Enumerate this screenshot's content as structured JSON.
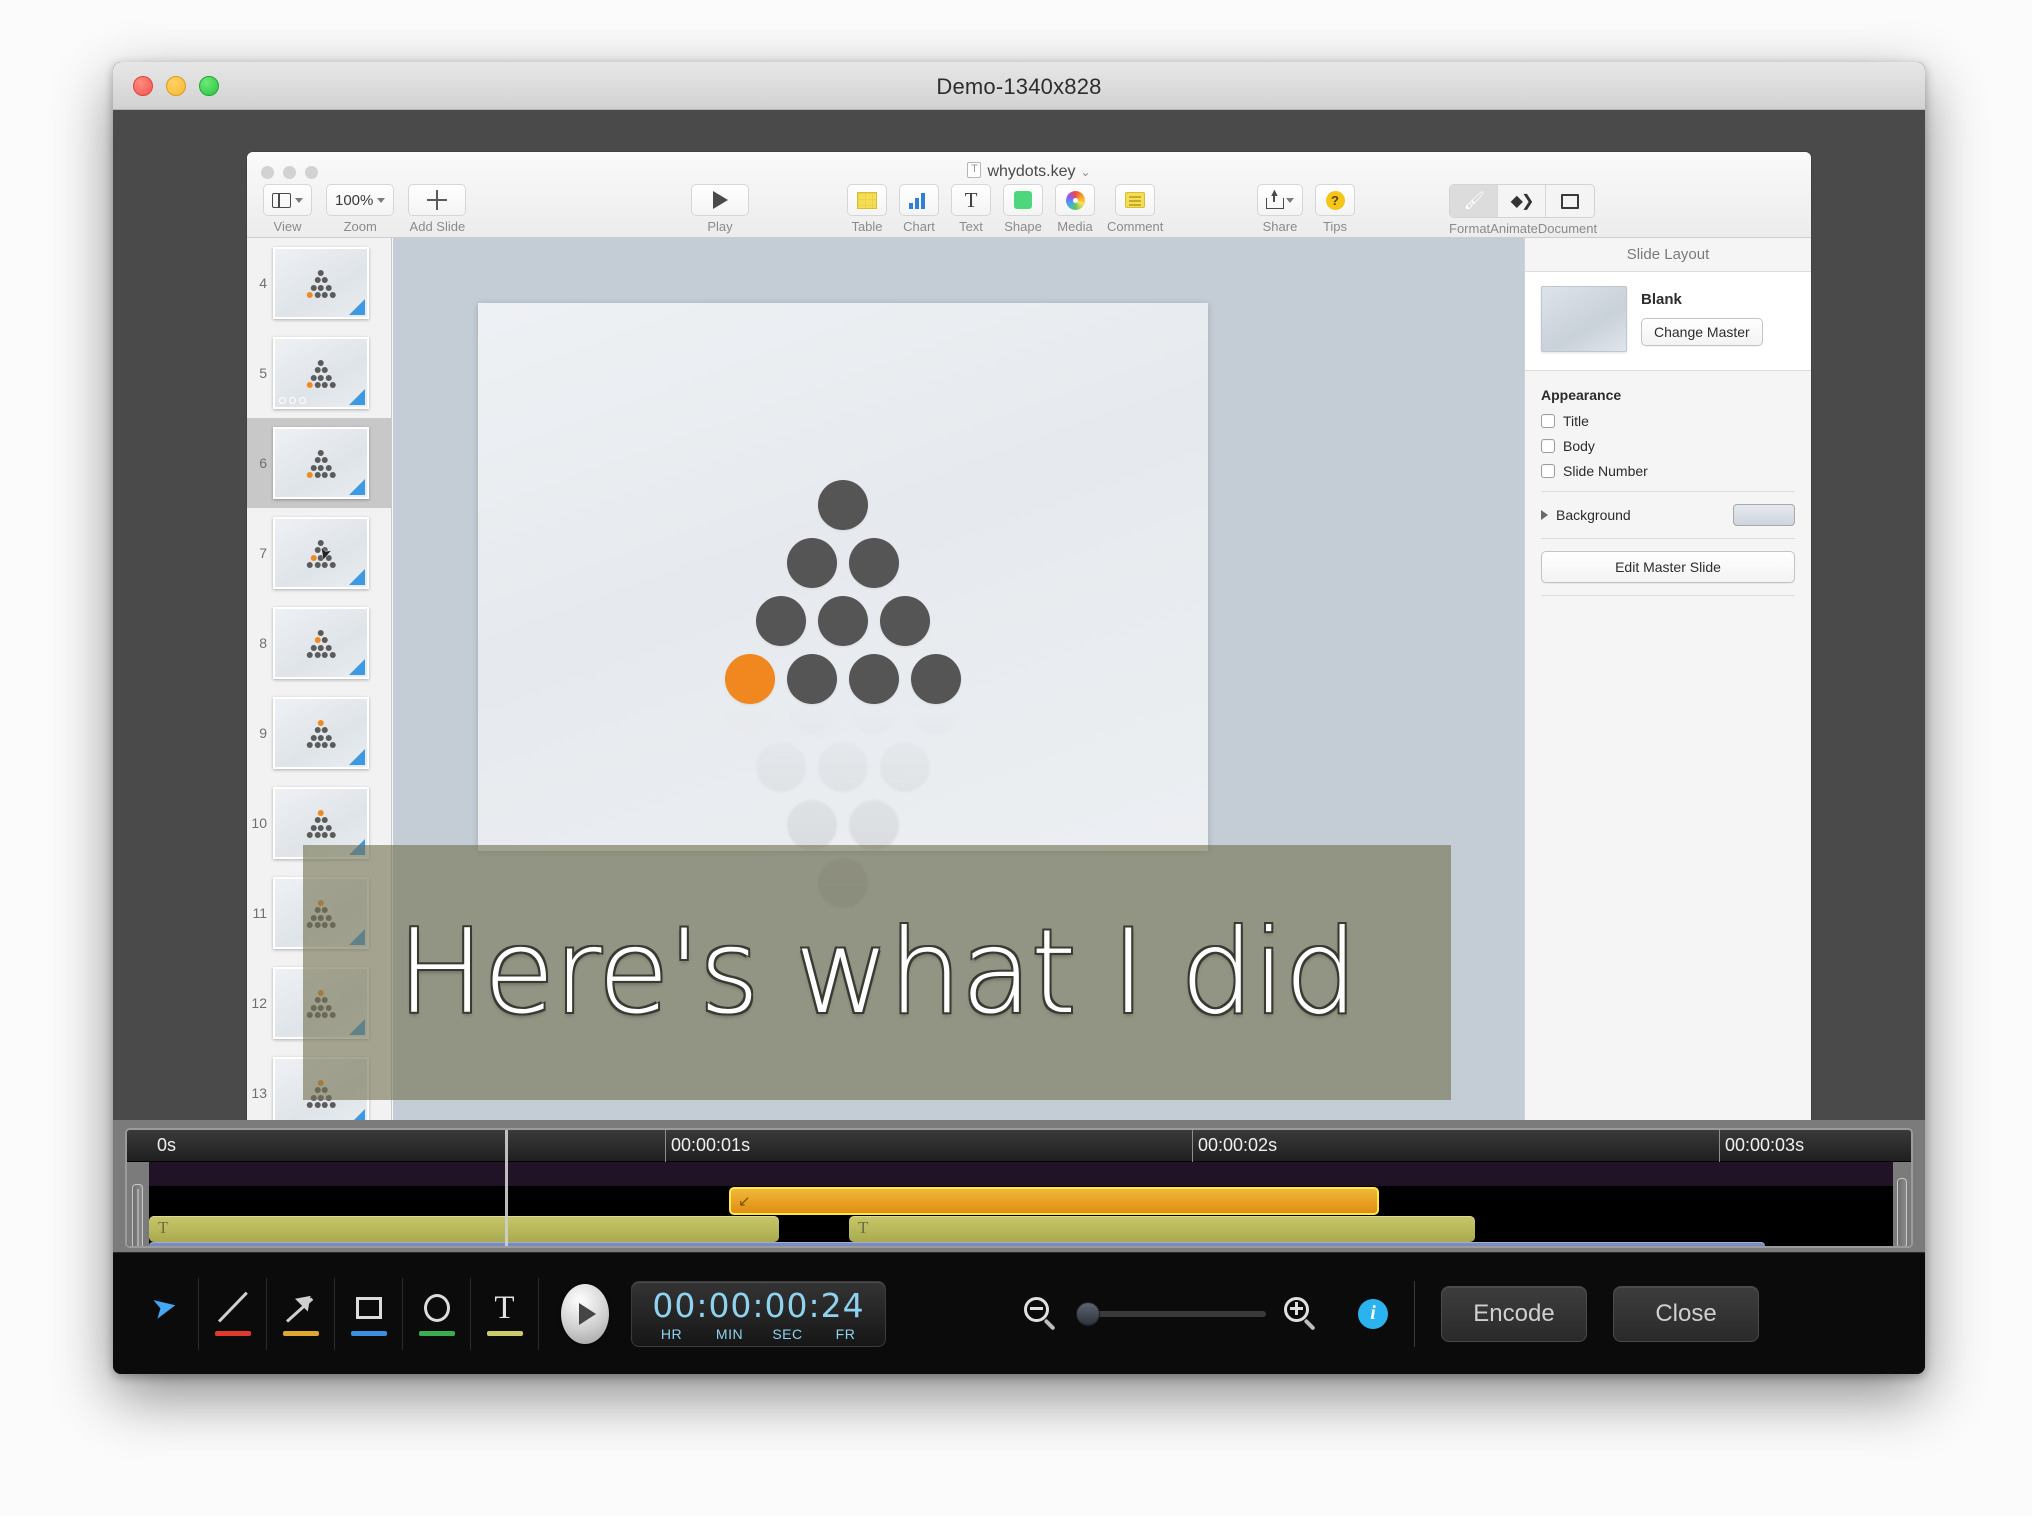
{
  "window": {
    "title": "Demo-1340x828",
    "traffic_lights": [
      "close",
      "minimize",
      "zoom"
    ]
  },
  "keynote": {
    "document_name": "whydots.key",
    "toolbar_left": [
      {
        "label": "View",
        "icon": "view-icon"
      },
      {
        "label": "Zoom",
        "icon": "zoom-value",
        "value": "100%"
      },
      {
        "label": "Add Slide",
        "icon": "plus-icon"
      }
    ],
    "toolbar_center": [
      {
        "label": "Play",
        "icon": "play-icon"
      },
      {
        "label": "Table",
        "icon": "table-icon"
      },
      {
        "label": "Chart",
        "icon": "chart-icon"
      },
      {
        "label": "Text",
        "icon": "text-icon"
      },
      {
        "label": "Shape",
        "icon": "shape-icon"
      },
      {
        "label": "Media",
        "icon": "media-icon"
      },
      {
        "label": "Comment",
        "icon": "comment-icon"
      }
    ],
    "toolbar_right": [
      {
        "label": "Share",
        "icon": "share-icon"
      },
      {
        "label": "Tips",
        "icon": "tips-icon"
      }
    ],
    "inspector_tabs": [
      {
        "label": "Format",
        "icon": "format-icon",
        "selected": true
      },
      {
        "label": "Animate",
        "icon": "animate-icon",
        "selected": false
      },
      {
        "label": "Document",
        "icon": "document-icon",
        "selected": false
      }
    ],
    "navigator": {
      "slides": [
        {
          "number": "4",
          "selected": false,
          "orange_position": "bottom-left",
          "cursor": false,
          "build_dots": 0
        },
        {
          "number": "5",
          "selected": false,
          "orange_position": "bottom-left",
          "cursor": false,
          "build_dots": 3
        },
        {
          "number": "6",
          "selected": true,
          "orange_position": "bottom-left",
          "cursor": false,
          "build_dots": 0
        },
        {
          "number": "7",
          "selected": false,
          "orange_position": "middle-left",
          "cursor": true,
          "build_dots": 0
        },
        {
          "number": "8",
          "selected": false,
          "orange_position": "second-left",
          "cursor": false,
          "build_dots": 0
        },
        {
          "number": "9",
          "selected": false,
          "orange_position": "apex",
          "cursor": false,
          "build_dots": 0
        },
        {
          "number": "10",
          "selected": false,
          "orange_position": "apex",
          "cursor": false,
          "build_dots": 0
        },
        {
          "number": "11",
          "selected": false,
          "orange_position": "apex",
          "cursor": false,
          "build_dots": 0
        },
        {
          "number": "12",
          "selected": false,
          "orange_position": "apex",
          "cursor": false,
          "build_dots": 0
        },
        {
          "number": "13",
          "selected": false,
          "orange_position": "apex",
          "cursor": false,
          "build_dots": 0
        }
      ]
    },
    "slide_canvas": {
      "pyramid": {
        "rows": [
          1,
          2,
          3,
          4
        ],
        "orange_index": {
          "row": 3,
          "col": 0
        },
        "dot_color": "#555555",
        "orange_color": "#f0881f"
      },
      "background_color": "#c4ccd5"
    },
    "inspector": {
      "title": "Slide Layout",
      "master_name": "Blank",
      "change_master_label": "Change Master",
      "appearance_heading": "Appearance",
      "checkboxes": [
        {
          "label": "Title",
          "checked": false
        },
        {
          "label": "Body",
          "checked": false
        },
        {
          "label": "Slide Number",
          "checked": false
        }
      ],
      "background_label": "Background",
      "background_swatch": "#d9dfe6",
      "edit_master_label": "Edit Master Slide"
    }
  },
  "caption": {
    "text": "Here's what I did",
    "background_color": "rgba(116,115,82,.62)",
    "text_color": "#ffffff"
  },
  "timeline": {
    "ruler_ticks": [
      "0s",
      "00:00:01s",
      "00:00:02s",
      "00:00:03s"
    ],
    "tracks": [
      {
        "name": "audio-track",
        "type": "empty",
        "color": "#201326"
      },
      {
        "name": "animation-track",
        "type": "clip",
        "color": "#e08e12",
        "border_color": "#ffe94a",
        "icon": "arrow-down-left-icon"
      },
      {
        "name": "text-track",
        "type": "clips",
        "color": "#a9a94f",
        "icon": "text-icon",
        "clip_count": 2
      },
      {
        "name": "slide-track",
        "type": "video",
        "color": "#6b7ab0"
      }
    ],
    "playhead_label": "playhead"
  },
  "bottom_toolbar": {
    "tools": [
      {
        "name": "select-tool",
        "icon": "cursor-arrow-icon",
        "underline_color": "none"
      },
      {
        "name": "line-tool",
        "icon": "line-icon",
        "underline_color": "#e03a2f"
      },
      {
        "name": "arrow-tool",
        "icon": "arrow-icon",
        "underline_color": "#e0a72f"
      },
      {
        "name": "rectangle-tool",
        "icon": "rectangle-icon",
        "underline_color": "#3a8fe0"
      },
      {
        "name": "ellipse-tool",
        "icon": "ellipse-icon",
        "underline_color": "#3aae4e"
      },
      {
        "name": "text-tool",
        "icon": "text-t-icon",
        "underline_color": "#cbcb6a"
      }
    ],
    "play_button": "play-icon",
    "timecode": {
      "value": "00:00:00:24",
      "segments": [
        "00",
        "00",
        "00",
        "24"
      ],
      "labels": [
        "HR",
        "MIN",
        "SEC",
        "FR"
      ],
      "color": "#8fd2f0"
    },
    "zoom_out_icon": "magnifier-minus-icon",
    "zoom_in_icon": "magnifier-plus-icon",
    "zoom_slider_value": 0,
    "info_icon": "info-icon",
    "encode_label": "Encode",
    "close_label": "Close"
  }
}
